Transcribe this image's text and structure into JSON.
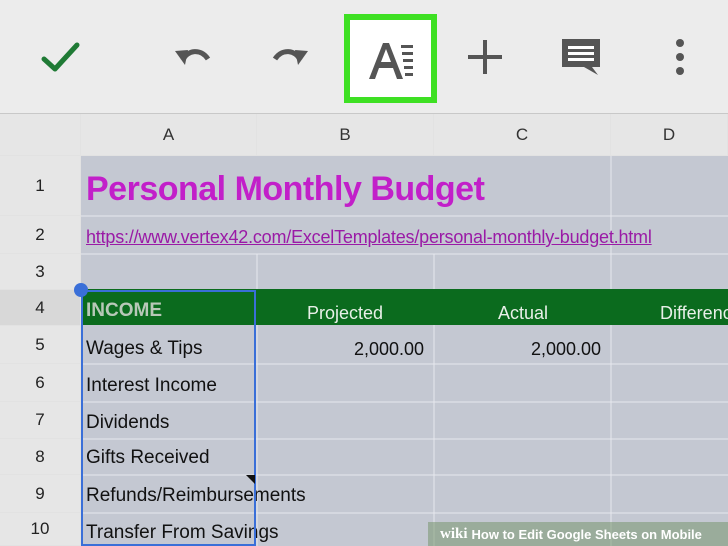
{
  "toolbar": {
    "icons": [
      "check-icon",
      "undo-icon",
      "redo-icon",
      "text-format-icon",
      "add-icon",
      "comment-icon",
      "more-icon"
    ],
    "highlight_color": "#3ee023"
  },
  "columns": [
    "A",
    "B",
    "C",
    "D"
  ],
  "rows": [
    "1",
    "2",
    "3",
    "4",
    "5",
    "6",
    "7",
    "8",
    "9",
    "10"
  ],
  "sheet": {
    "title": "Personal Monthly Budget",
    "url": "https://www.vertex42.com/ExcelTemplates/personal-monthly-budget.html",
    "income_header": "INCOME",
    "projected_header": "Projected",
    "actual_header": "Actual",
    "difference_header": "Differenc",
    "items": [
      "Wages & Tips",
      "Interest Income",
      "Dividends",
      "Gifts Received",
      "Refunds/Reimbursements",
      "Transfer From Savings"
    ],
    "wages_projected": "2,000.00",
    "wages_actual": "2,000.00"
  },
  "watermark": {
    "brand": "wiki",
    "text": "How to Edit Google Sheets on Mobile"
  },
  "colors": {
    "title": "#c21fc9",
    "header_band": "#0b6b1e",
    "selection": "#3a6fd8"
  }
}
